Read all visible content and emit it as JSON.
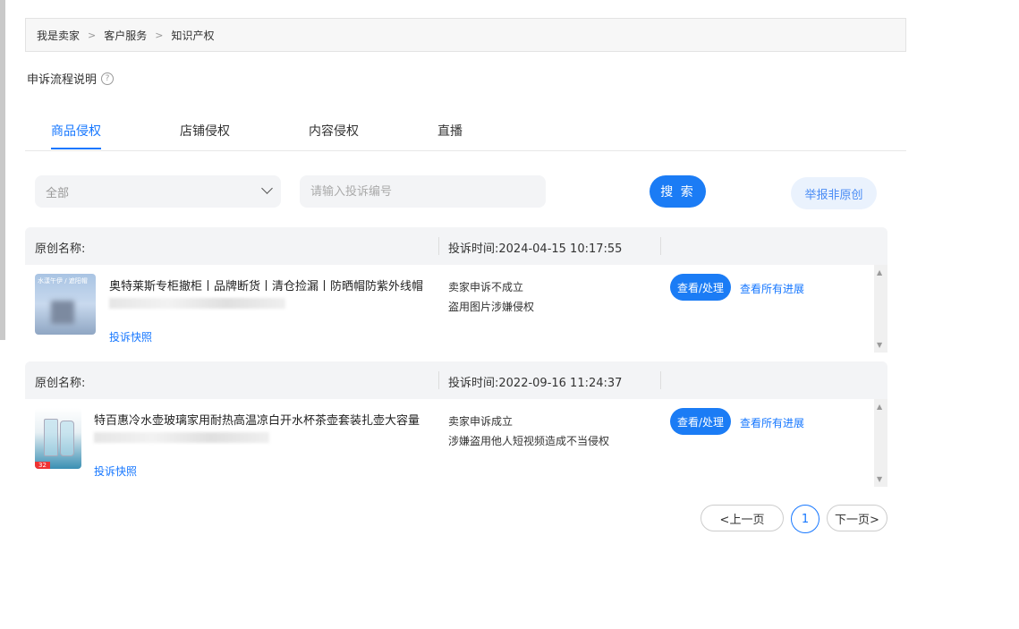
{
  "breadcrumb": [
    "我是卖家",
    "客户服务",
    "知识产权"
  ],
  "breadcrumb_sep": ">",
  "flow_title": "申诉流程说明",
  "tabs": [
    {
      "label": "商品侵权",
      "active": true
    },
    {
      "label": "店铺侵权",
      "active": false
    },
    {
      "label": "内容侵权",
      "active": false
    },
    {
      "label": "直播",
      "active": false
    }
  ],
  "filters": {
    "status_selected": "全部",
    "search_placeholder": "请输入投诉编号",
    "search_label": "搜 索",
    "report_label": "举报非原创"
  },
  "records": [
    {
      "orig_label": "原创名称:",
      "time": "投诉时间:2024-04-15 10:17:55",
      "thumb_text": "水漾午伊 / 遮阳帽",
      "title": "奥特莱斯专柜撤柜丨品牌断货丨清仓捡漏丨防晒帽防紫外线帽",
      "snapshot": "投诉快照",
      "status": "卖家申诉不成立",
      "reason": "盗用图片涉嫌侵权",
      "action": "查看/处理",
      "progress": "查看所有进展"
    },
    {
      "orig_label": "原创名称:",
      "time": "投诉时间:2022-09-16 11:24:37",
      "thumb_text": "32",
      "title": "特百惠冷水壶玻璃家用耐热高温凉白开水杯茶壶套装扎壶大容量",
      "snapshot": "投诉快照",
      "status": "卖家申诉成立",
      "reason": "涉嫌盗用他人短视频造成不当侵权",
      "action": "查看/处理",
      "progress": "查看所有进展"
    }
  ],
  "pagination": {
    "prev": "<上一页",
    "current": "1",
    "next": "下一页>"
  },
  "colors": {
    "primary": "#1b7cf5",
    "link": "#1677ff",
    "panel": "#f3f4f6"
  }
}
